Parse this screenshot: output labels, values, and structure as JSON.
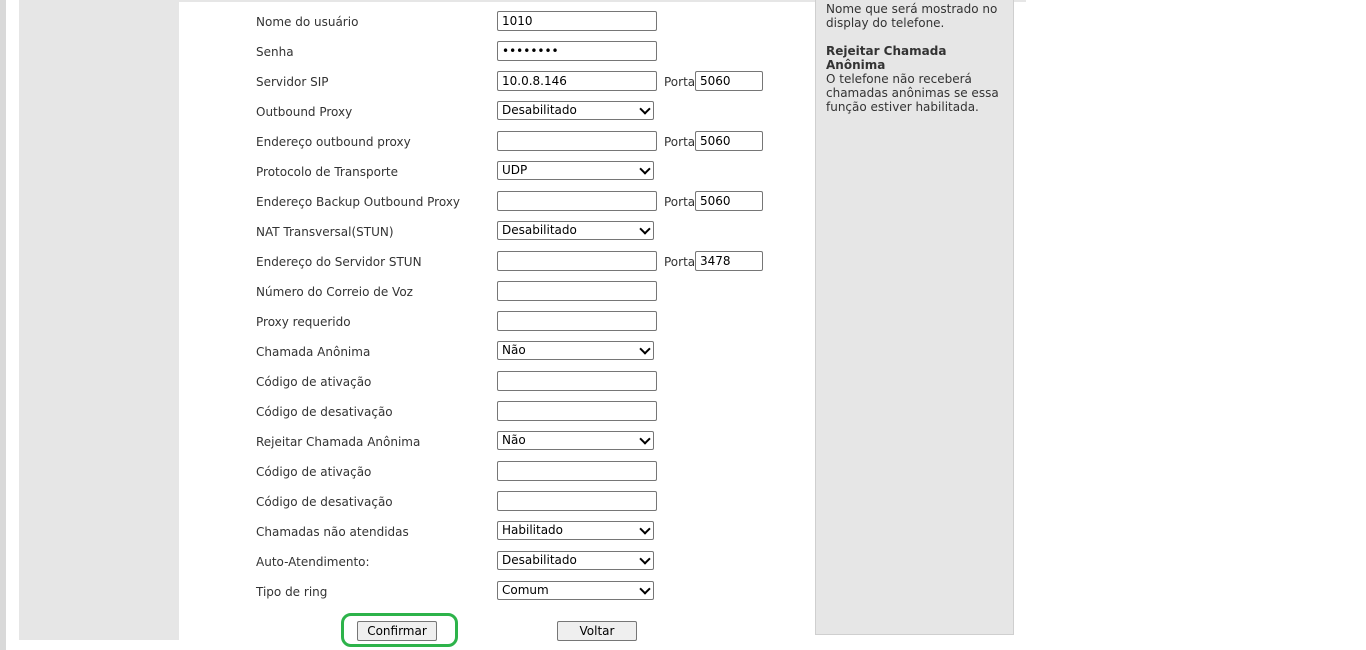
{
  "help": {
    "display_name_text": "Nome que será mostrado no display do telefone.",
    "reject_title": "Rejeitar Chamada Anônima",
    "reject_text": "O telefone não receberá chamadas anônimas se essa função estiver habilitada."
  },
  "port_label": "Porta",
  "form": {
    "username": {
      "label": "Nome do usuário",
      "value": "1010"
    },
    "password": {
      "label": "Senha",
      "value": "12345678"
    },
    "sip_server": {
      "label": "Servidor SIP",
      "value": "10.0.8.146",
      "port": "5060"
    },
    "outbound_proxy": {
      "label": "Outbound Proxy",
      "selected": "Desabilitado"
    },
    "outbound_proxy_address": {
      "label": "Endereço outbound proxy",
      "value": "",
      "port": "5060"
    },
    "transport": {
      "label": "Protocolo de Transporte",
      "selected": "UDP"
    },
    "backup_outbound_proxy": {
      "label": "Endereço Backup Outbound Proxy",
      "value": "",
      "port": "5060"
    },
    "nat_stun": {
      "label": "NAT Transversal(STUN)",
      "selected": "Desabilitado"
    },
    "stun_server": {
      "label": "Endereço do Servidor STUN",
      "value": "",
      "port": "3478"
    },
    "voicemail": {
      "label": "Número do Correio de Voz",
      "value": ""
    },
    "proxy_required": {
      "label": "Proxy requerido",
      "value": ""
    },
    "anonymous_call": {
      "label": "Chamada Anônima",
      "selected": "Não"
    },
    "anon_activation": {
      "label": "Código de ativação",
      "value": ""
    },
    "anon_deactivation": {
      "label": "Código de desativação",
      "value": ""
    },
    "reject_anonymous": {
      "label": "Rejeitar Chamada Anônima",
      "selected": "Não"
    },
    "reject_activation": {
      "label": "Código de ativação",
      "value": ""
    },
    "reject_deactivation": {
      "label": "Código de desativação",
      "value": ""
    },
    "missed_calls": {
      "label": "Chamadas não atendidas",
      "selected": "Habilitado"
    },
    "auto_answer": {
      "label": "Auto-Atendimento:",
      "selected": "Desabilitado"
    },
    "ring_type": {
      "label": "Tipo de ring",
      "selected": "Comum"
    }
  },
  "buttons": {
    "confirm": "Confirmar",
    "back": "Voltar"
  },
  "colors": {
    "highlight": "#2db34a",
    "panel_bg": "#e6e6e6"
  }
}
